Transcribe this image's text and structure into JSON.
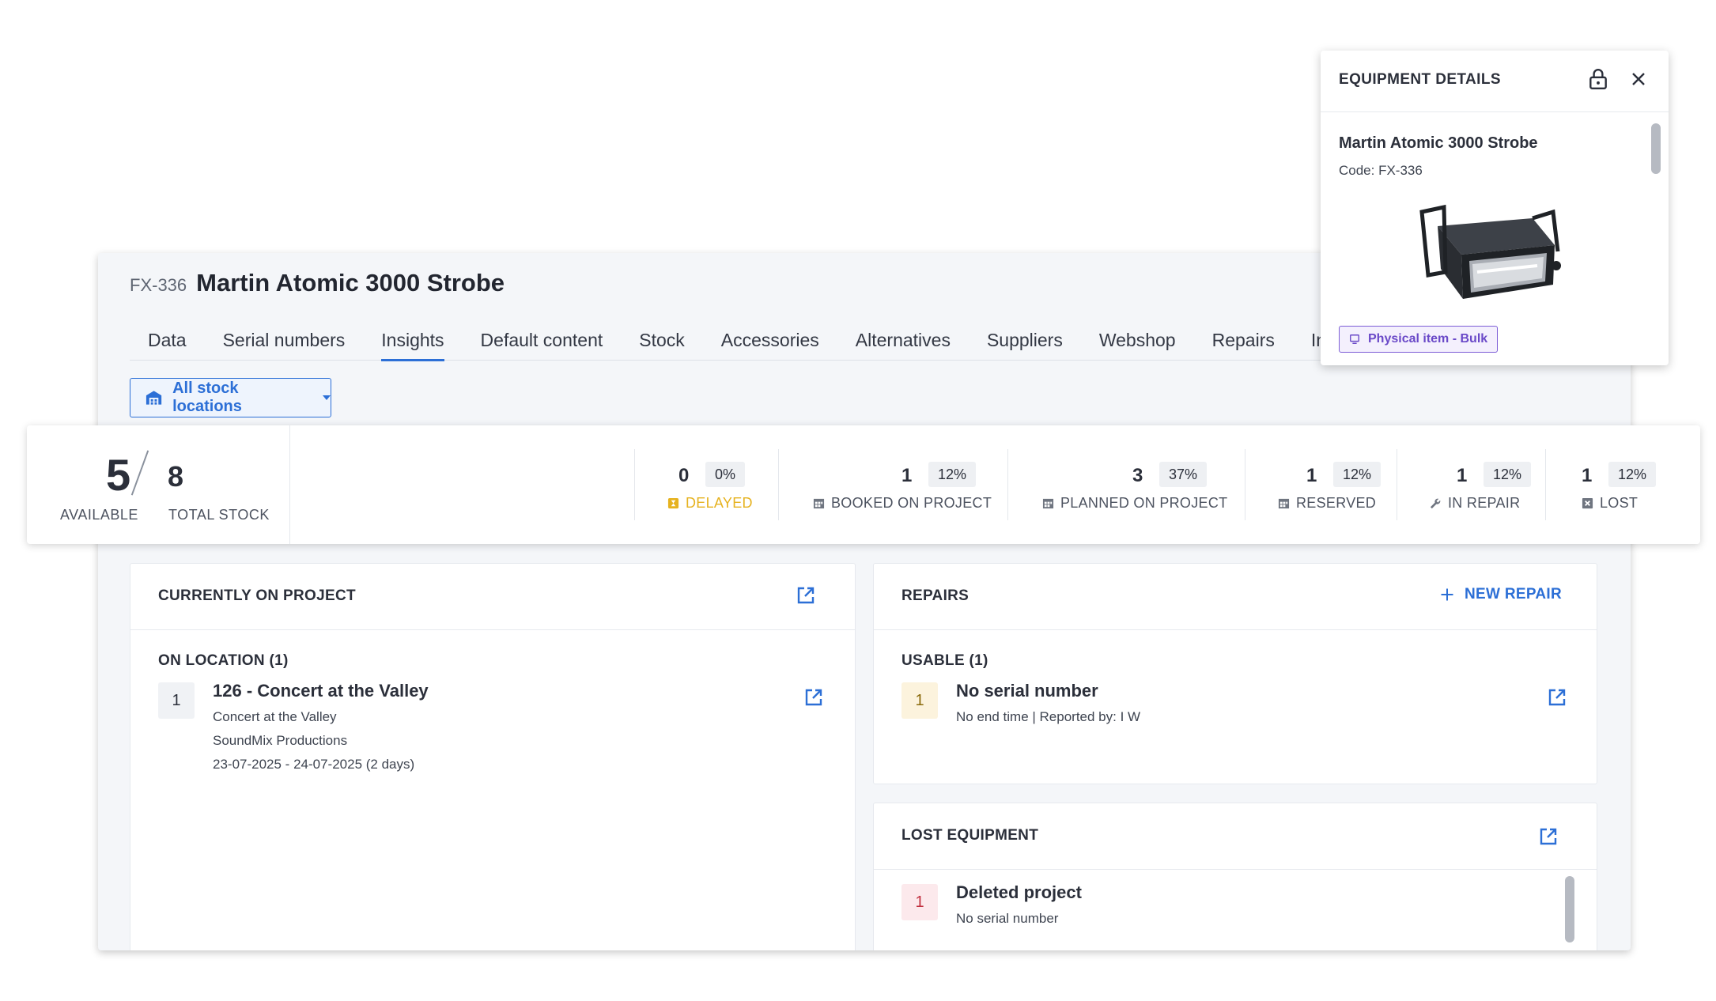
{
  "item": {
    "code": "FX-336",
    "title": "Martin Atomic 3000 Strobe"
  },
  "tabs": [
    {
      "label": "Data"
    },
    {
      "label": "Serial numbers"
    },
    {
      "label": "Insights"
    },
    {
      "label": "Default content"
    },
    {
      "label": "Stock"
    },
    {
      "label": "Accessories"
    },
    {
      "label": "Alternatives"
    },
    {
      "label": "Suppliers"
    },
    {
      "label": "Webshop"
    },
    {
      "label": "Repairs"
    },
    {
      "label": "Inventory"
    }
  ],
  "location_filter": {
    "label": "All stock locations"
  },
  "stats": {
    "available": "5",
    "total": "8",
    "available_label": "AVAILABLE",
    "total_label": "TOTAL STOCK",
    "items": [
      {
        "value": "0",
        "pct": "0%",
        "label": "DELAYED"
      },
      {
        "value": "1",
        "pct": "12%",
        "label": "BOOKED ON PROJECT"
      },
      {
        "value": "3",
        "pct": "37%",
        "label": "PLANNED ON PROJECT"
      },
      {
        "value": "1",
        "pct": "12%",
        "label": "RESERVED"
      },
      {
        "value": "1",
        "pct": "12%",
        "label": "IN REPAIR"
      },
      {
        "value": "1",
        "pct": "12%",
        "label": "LOST"
      }
    ]
  },
  "current_project": {
    "title": "CURRENTLY ON PROJECT",
    "section": "ON LOCATION (1)",
    "entry": {
      "qty": "1",
      "title": "126 - Concert at the Valley",
      "line1": "Concert at the Valley",
      "line2": "SoundMix Productions",
      "line3": "23-07-2025 - 24-07-2025 (2 days)"
    }
  },
  "repairs": {
    "title": "REPAIRS",
    "new_label": "NEW REPAIR",
    "section": "USABLE (1)",
    "entry": {
      "qty": "1",
      "title": "No serial number",
      "line1": "No end time | Reported by: I W"
    }
  },
  "lost": {
    "title": "LOST EQUIPMENT",
    "entry": {
      "qty": "1",
      "title": "Deleted project",
      "line1": "No serial number"
    }
  },
  "details": {
    "title": "EQUIPMENT DETAILS",
    "name": "Martin Atomic 3000 Strobe",
    "code": "Code: FX-336",
    "badge": "Physical item - Bulk"
  },
  "colors": {
    "accent": "#2c6fd6",
    "delayed": "#e6b21f",
    "badge": "#6a49c8"
  }
}
